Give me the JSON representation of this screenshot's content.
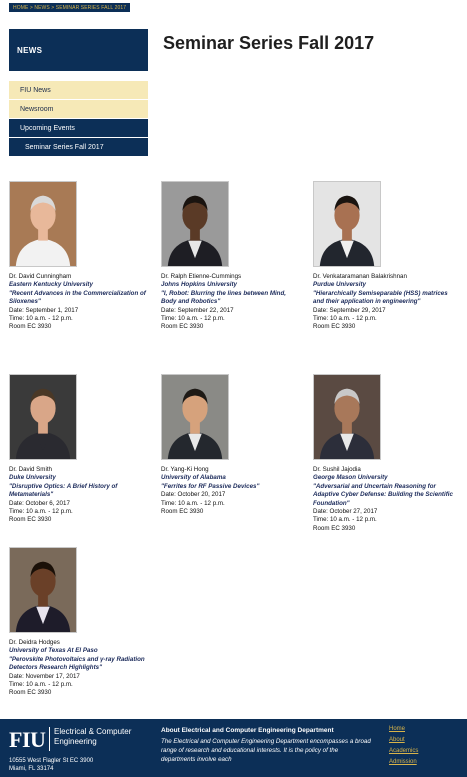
{
  "breadcrumb": "HOME > NEWS > SEMINAR SERIES FALL 2017",
  "sidebar": {
    "title": "NEWS",
    "items": [
      {
        "label": "FIU News"
      },
      {
        "label": "Newsroom"
      },
      {
        "label": "Upcoming Events"
      },
      {
        "label": "Seminar Series Fall 2017"
      }
    ]
  },
  "page_title": "Seminar Series Fall 2017",
  "speakers": [
    {
      "name": "Dr. David Cunningham",
      "affiliation": "Eastern Kentucky University",
      "title": "\"Recent Advances in the Commercialization of Siloxenes\"",
      "date": "Date: September 1, 2017",
      "time": "Time: 10 a.m. - 12 p.m.",
      "room": "Room EC 3930",
      "skin": "#e8b89a",
      "hair": "#d9d9d9",
      "shirt": "#f2f2f2",
      "jacket": "#f2f2f2",
      "bg": "#a87a55"
    },
    {
      "name": "Dr. Ralph Etienne-Cummings",
      "affiliation": "Johns Hopkins University",
      "title": "\"I, Robot: Blurring the lines between Mind, Body and Robotics\"",
      "date": "Date: September 22, 2017",
      "time": "Time: 10 a.m. - 12 p.m.",
      "room": "Room EC 3930",
      "skin": "#5a3a26",
      "hair": "#1a1410",
      "shirt": "#e8e8e8",
      "jacket": "#1e1e24",
      "bg": "#9a9a9a"
    },
    {
      "name": "Dr. Venkataramanan Balakrishnan",
      "affiliation": "Purdue University",
      "title": "\"Hierarchically Semiseparable (HSS) matrices and their application in engineering\"",
      "date": "Date: September 29, 2017",
      "time": "Time: 10 a.m. - 12 p.m.",
      "room": "Room EC 3930",
      "skin": "#a87152",
      "hair": "#1a1410",
      "shirt": "#f0f0f0",
      "jacket": "#22262e",
      "bg": "#e4e4e4"
    },
    {
      "name": "Dr. David Smith",
      "affiliation": "Duke University",
      "title": "\"Disruptive Optics: A Brief History of Metamaterials\"",
      "date": "Date: October 6, 2017",
      "time": "Time: 10 a.m. - 12 p.m.",
      "room": "Room EC 3930",
      "skin": "#d9a688",
      "hair": "#4a3826",
      "shirt": "#2a2a30",
      "jacket": "#2a2a30",
      "bg": "#3a3a3a"
    },
    {
      "name": "Dr. Yang-Ki Hong",
      "affiliation": "University of Alabama",
      "title": "\"Ferrites for RF Passive Devices\"",
      "date": "Date: October 20, 2017",
      "time": "Time: 10 a.m. - 12 p.m.",
      "room": "Room EC 3930",
      "skin": "#d6a27c",
      "hair": "#1e1a16",
      "shirt": "#e8e8e8",
      "jacket": "#24282e",
      "bg": "#8a8a86"
    },
    {
      "name": "Dr. Sushil Jajodia",
      "affiliation": "George Mason University",
      "title": "\"Adversarial and Uncertain Reasoning for Adaptive Cyber Defense: Building the Scientific Foundation\"",
      "date": "Date: October 27, 2017",
      "time": "Time: 10 a.m. - 12 p.m.",
      "room": "Room EC 3930",
      "skin": "#a8785a",
      "hair": "#c8c8c8",
      "shirt": "#e8e8e8",
      "jacket": "#2c2e3a",
      "bg": "#5a4a42"
    },
    {
      "name": "Dr. Deidra Hodges",
      "affiliation": "University of Texas At El Paso",
      "title": "\"Perovskite Photovoltaics and γ-ray Radiation Detectors Research Highlights\"",
      "date": "Date: November 17, 2017",
      "time": "Time: 10 a.m. - 12 p.m.",
      "room": "Room EC 3930",
      "skin": "#6a4028",
      "hair": "#1a1008",
      "shirt": "#e8e4ee",
      "jacket": "#1e1c2a",
      "bg": "#7a6a5a"
    }
  ],
  "footer": {
    "logo": "FIU",
    "dept_line1": "Electrical & Computer",
    "dept_line2": "Engineering",
    "address_line1": "10555 West Flagler St EC 3900",
    "address_line2": "Miami, FL 33174",
    "about_title": "About Electrical and Computer Engineering Department",
    "about_text": "The Electrical and Computer Engineering Department encompasses a broad range of research and educational interests. It is the policy of the departments involve each",
    "links": [
      "Home",
      "About",
      "Academics",
      "Admission"
    ]
  },
  "colors": {
    "navy": "#0c2f57",
    "gold": "#d8b44a",
    "nav_light": "#f6e9b7"
  }
}
